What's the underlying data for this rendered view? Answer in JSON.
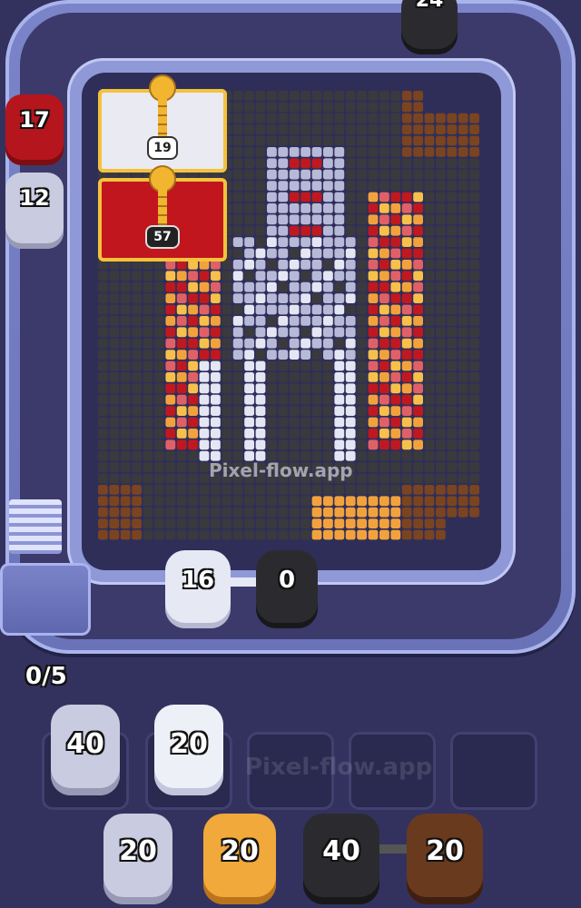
{
  "game": {
    "progress": "0/5",
    "watermark": "Pixel-flow.app",
    "top_shooter_count": "24"
  },
  "chests": [
    {
      "name": "white-chest",
      "count": "19",
      "color": "#e9eaf2"
    },
    {
      "name": "red-chest",
      "count": "57",
      "color": "#c1161d"
    }
  ],
  "track_shooters": [
    {
      "name": "red-shooter",
      "count": "17",
      "color": "#b5151c"
    },
    {
      "name": "gray-shooter",
      "count": "12",
      "color": "#c9cbe0"
    }
  ],
  "active_pair": {
    "left": {
      "count": "16",
      "color": "#e6e8f3"
    },
    "right": {
      "count": "0",
      "color": "#2b2b2f"
    }
  },
  "slots": [
    {
      "count": "40",
      "color": "#c9cbe0"
    },
    {
      "count": "20",
      "color": "#eef0f8"
    }
  ],
  "queue": [
    {
      "count": "20",
      "color": "#c9cbe0"
    },
    {
      "count": "20",
      "color": "#f0a93a"
    },
    {
      "count": "40",
      "color": "#2b2b2f"
    },
    {
      "count": "20",
      "color": "#6a3a1f"
    }
  ],
  "palette": {
    "dark": "#3a3a3e",
    "red": "#c01820",
    "pink": "#e06068",
    "orange": "#f2a23c",
    "yellow": "#f6c04a",
    "white": "#e4e6f4",
    "lavender": "#b7b9d8",
    "brown": "#7a4420"
  }
}
